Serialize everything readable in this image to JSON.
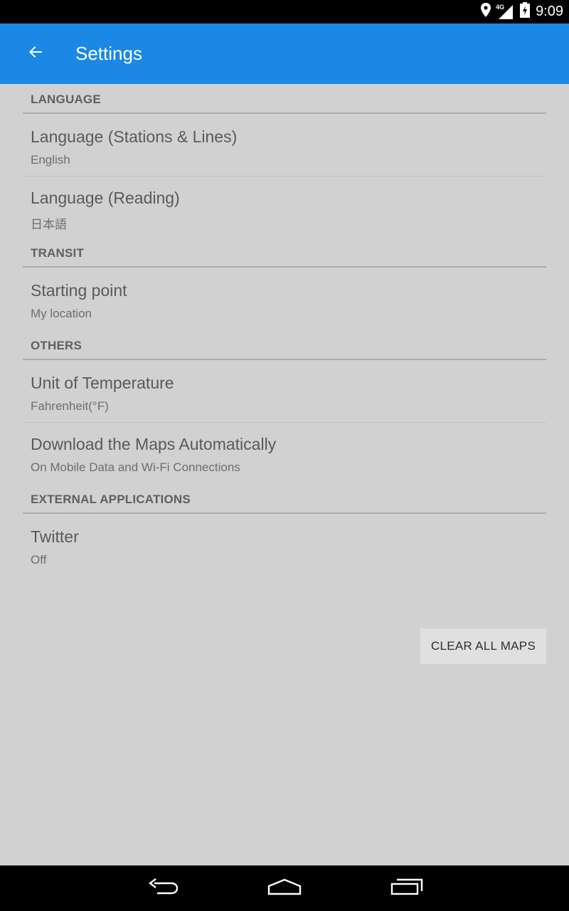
{
  "status_bar": {
    "time": "9:09",
    "network_label": "4G",
    "icons": [
      "location-icon",
      "signal-icon",
      "battery-icon"
    ]
  },
  "app_bar": {
    "title": "Settings",
    "back_icon": "arrow-left-icon",
    "color": "#1a88e4"
  },
  "sections": [
    {
      "header": "LANGUAGE",
      "items": [
        {
          "title": "Language (Stations & Lines)",
          "summary": "English"
        },
        {
          "title": "Language (Reading)",
          "summary": "日本語"
        }
      ]
    },
    {
      "header": "TRANSIT",
      "items": [
        {
          "title": "Starting point",
          "summary": "My location"
        }
      ]
    },
    {
      "header": "OTHERS",
      "items": [
        {
          "title": "Unit of Temperature",
          "summary": "Fahrenheit(°F)"
        },
        {
          "title": "Download the Maps Automatically",
          "summary": "On Mobile Data and Wi-Fi Connections"
        }
      ]
    },
    {
      "header": "EXTERNAL APPLICATIONS",
      "items": [
        {
          "title": "Twitter",
          "summary": "Off"
        }
      ]
    }
  ],
  "clear_button": "CLEAR ALL MAPS",
  "nav_bar": {
    "icons": [
      "back-icon",
      "home-icon",
      "recents-icon"
    ]
  }
}
